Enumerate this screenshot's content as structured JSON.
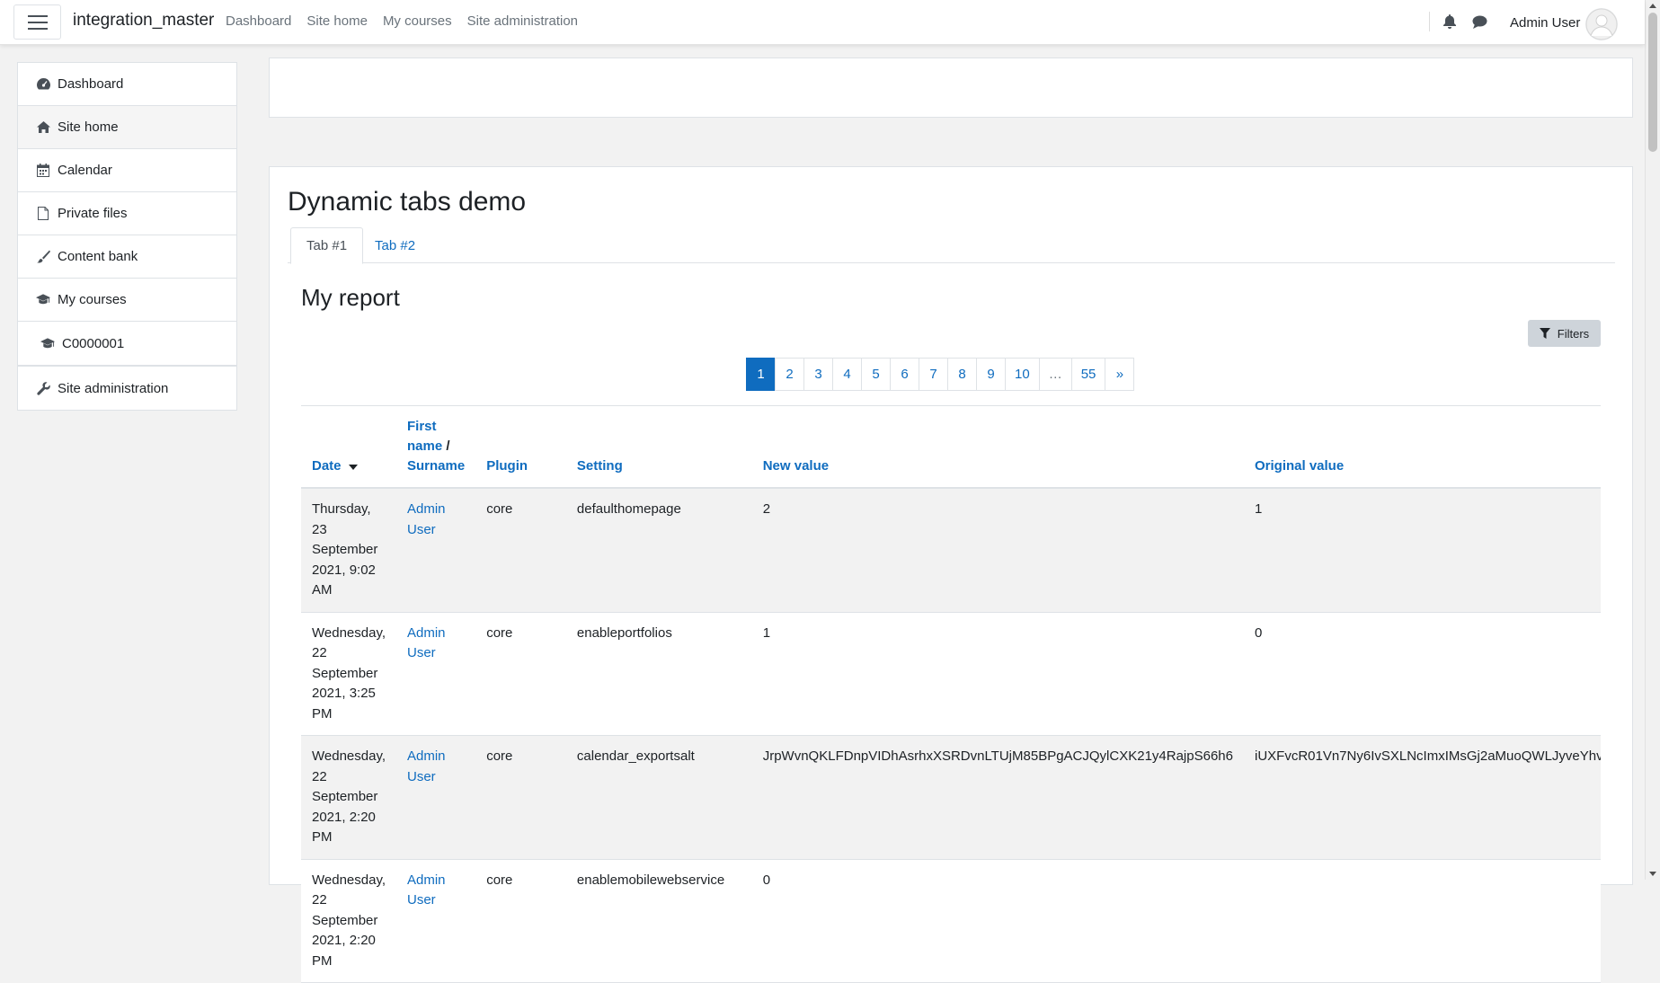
{
  "navbar": {
    "brand": "integration_master",
    "links": [
      "Dashboard",
      "Site home",
      "My courses",
      "Site administration"
    ],
    "user_name": "Admin User"
  },
  "drawer": {
    "items": [
      {
        "label": "Dashboard",
        "icon": "dashboard-icon"
      },
      {
        "label": "Site home",
        "icon": "home-icon"
      },
      {
        "label": "Calendar",
        "icon": "calendar-icon"
      },
      {
        "label": "Private files",
        "icon": "file-icon"
      },
      {
        "label": "Content bank",
        "icon": "brush-icon"
      },
      {
        "label": "My courses",
        "icon": "graduation-cap-icon"
      },
      {
        "label": "C0000001",
        "icon": "graduation-cap-icon"
      }
    ],
    "admin": {
      "label": "Site administration",
      "icon": "wrench-icon"
    }
  },
  "main": {
    "title": "Dynamic tabs demo",
    "tabs": [
      "Tab #1",
      "Tab #2"
    ],
    "report_title": "My report",
    "filters_label": "Filters",
    "pagination": [
      "1",
      "2",
      "3",
      "4",
      "5",
      "6",
      "7",
      "8",
      "9",
      "10",
      "…",
      "55",
      "»"
    ],
    "table": {
      "headers": {
        "date": "Date",
        "first_name": "First name",
        "sep": " / ",
        "surname": "Surname",
        "plugin": "Plugin",
        "setting": "Setting",
        "new_value": "New value",
        "original_value": "Original value"
      },
      "rows": [
        {
          "date": "Thursday, 23 September 2021, 9:02 AM",
          "user": "Admin User",
          "plugin": "core",
          "setting": "defaulthomepage",
          "new_value": "2",
          "original_value": "1"
        },
        {
          "date": "Wednesday, 22 September 2021, 3:25 PM",
          "user": "Admin User",
          "plugin": "core",
          "setting": "enableportfolios",
          "new_value": "1",
          "original_value": "0"
        },
        {
          "date": "Wednesday, 22 September 2021, 2:20 PM",
          "user": "Admin User",
          "plugin": "core",
          "setting": "calendar_exportsalt",
          "new_value": "JrpWvnQKLFDnpVIDhAsrhxXSRDvnLTUjM85BPgACJQylCXK21y4RajpS66h6",
          "original_value": "iUXFvcR01Vn7Ny6IvSXLNcImxIMsGj2aMuoQWLJyveYhv"
        },
        {
          "date": "Wednesday, 22 September 2021, 2:20 PM",
          "user": "Admin User",
          "plugin": "core",
          "setting": "enablemobilewebservice",
          "new_value": "0",
          "original_value": ""
        }
      ]
    }
  }
}
